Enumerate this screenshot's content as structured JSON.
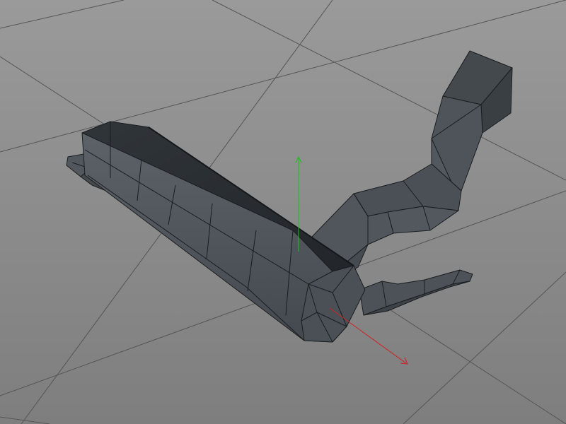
{
  "viewport": {
    "background_top": "#9a9a9a",
    "background_bottom": "#7e7e7e",
    "grid_color": "#555555",
    "mesh_face_color": "#3f4549",
    "mesh_face_light": "#5b6166",
    "mesh_edge_color": "#1a1d20",
    "axis_y_color": "#22bb22",
    "axis_x_color": "#cc2222"
  }
}
